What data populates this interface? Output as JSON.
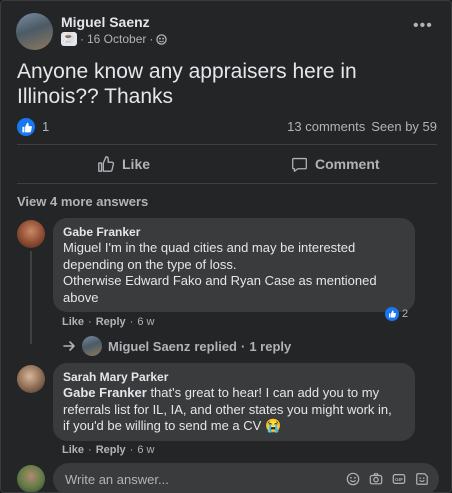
{
  "post": {
    "author": "Miguel Saenz",
    "date": "16 October",
    "text": "Anyone know any appraisers here in Illinois?? Thanks",
    "reaction_count": "1",
    "comments_count": "13 comments",
    "seen_by": "Seen by 59"
  },
  "actions": {
    "like": "Like",
    "comment": "Comment"
  },
  "view_more": "View 4 more answers",
  "comments": [
    {
      "author": "Gabe Franker",
      "lines": [
        "Miguel I'm in the quad cities and may be interested",
        "depending on the type of loss.",
        "Otherwise Edward Fako and Ryan Case as mentioned",
        "above"
      ],
      "like": "Like",
      "reply": "Reply",
      "time": "6 w",
      "reactions": "2"
    },
    {
      "author": "Sarah Mary Parker",
      "mention": "Gabe Franker",
      "lines": [
        " that's great to hear! I can add you to my",
        "referrals list for IL, IA, and other states you might work in,",
        "if you'd be willing to send me a CV"
      ],
      "emoji": "😭",
      "like": "Like",
      "reply": "Reply",
      "time": "6 w"
    }
  ],
  "replied": {
    "name": "Miguel Saenz",
    "text": "replied",
    "count": "1 reply"
  },
  "composer": {
    "placeholder": "Write an answer..."
  },
  "colors": {
    "accent": "#1877f2",
    "card": "#242526",
    "bubble": "#3a3b3c"
  }
}
